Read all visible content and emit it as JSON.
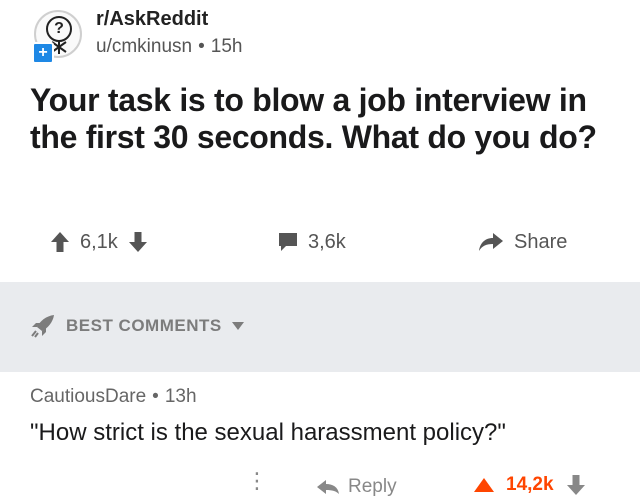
{
  "post": {
    "subreddit": "r/AskReddit",
    "author": "u/cmkinusn",
    "age": "15h",
    "title": "Your task is to blow a job interview in the first 30 seconds. What do you do?",
    "upvotes": "6,1k",
    "comments": "3,6k",
    "share_label": "Share"
  },
  "sort": {
    "label": "BEST COMMENTS"
  },
  "comment": {
    "author": "CautiousDare",
    "age": "13h",
    "text": "\"How strict is the sexual harassment policy?\"",
    "more_icon": "more-icon",
    "reply_label": "Reply",
    "votes": "14,2k"
  },
  "icons": {
    "subreddit_avatar": "question-mark-avatar",
    "join": "plus-icon",
    "upvote": "arrow-up-icon",
    "downvote": "arrow-down-icon",
    "comment": "comment-icon",
    "share": "share-icon",
    "sort": "rocket-icon",
    "caret": "caret-down-icon",
    "reply": "reply-icon"
  },
  "colors": {
    "accent_orange": "#ff4500",
    "join_blue": "#1e88e5",
    "muted": "#7c7c7c"
  }
}
